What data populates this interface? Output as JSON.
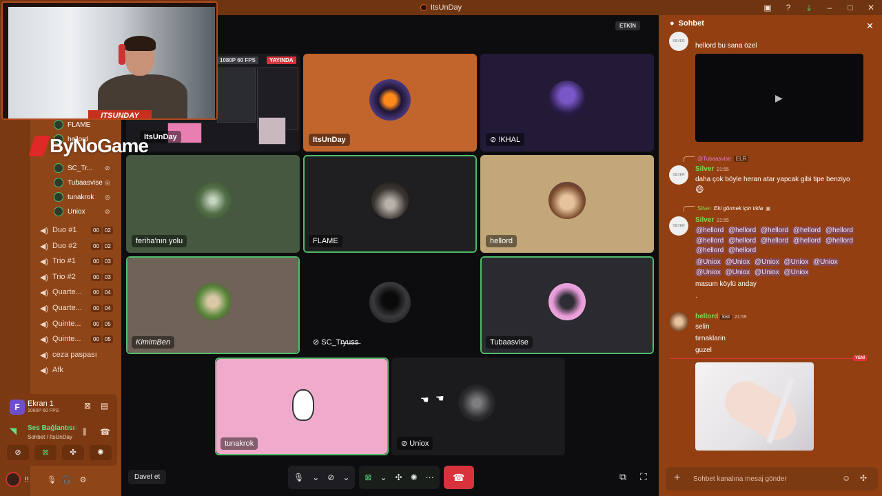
{
  "window": {
    "title": "ItsUnDay"
  },
  "titlebar_icons": [
    "inbox-icon",
    "help-icon",
    "download-icon",
    "minimize-icon",
    "maximize-icon",
    "close-icon"
  ],
  "overlay": {
    "banner": "ITSUNDAY",
    "brand": "ByNoGame"
  },
  "voice_members": [
    {
      "name": "FLAME"
    },
    {
      "name": "hellord"
    },
    {
      "name": "SC_Tr..."
    },
    {
      "name": "Tubaasvise"
    },
    {
      "name": "tunakrok"
    },
    {
      "name": "Uniox"
    }
  ],
  "voice_channels": [
    {
      "name": "Duo #1",
      "a": "00",
      "b": "02"
    },
    {
      "name": "Duo #2",
      "a": "00",
      "b": "02"
    },
    {
      "name": "Trio #1",
      "a": "00",
      "b": "03"
    },
    {
      "name": "Trio #2",
      "a": "00",
      "b": "03"
    },
    {
      "name": "Quarte...",
      "a": "00",
      "b": "04"
    },
    {
      "name": "Quarte...",
      "a": "00",
      "b": "04"
    },
    {
      "name": "Quinte...",
      "a": "00",
      "b": "05"
    },
    {
      "name": "Quinte...",
      "a": "00",
      "b": "05"
    },
    {
      "name": "ceza paspası",
      "a": "",
      "b": ""
    },
    {
      "name": "Afk",
      "a": "",
      "b": ""
    }
  ],
  "screen_share": {
    "icon_letter": "F",
    "title": "Ekran 1",
    "sub": "1080P 60 FPS"
  },
  "voice_connection": {
    "title": "Ses Bağlantısı K",
    "sub": "Sohbet / ItsUnDay"
  },
  "user": {
    "name": "!!"
  },
  "stage": {
    "etkin": "ETKİN",
    "preview": {
      "fps": "1080P 60 FPS",
      "live": "YAYINDA",
      "label": "ItsUnDay"
    },
    "tiles": [
      {
        "label": "ItsUnDay",
        "bg": "#c2652d"
      },
      {
        "label": "!KHAL",
        "bg": "#221a36"
      },
      {
        "label": "feriha'nın yolu",
        "bg": "#46583f"
      },
      {
        "label": "FLAME",
        "bg": "#1f1f22"
      },
      {
        "label": "hellord",
        "bg": "#c2a878"
      },
      {
        "label": "KimimBen",
        "bg": "#6f6358"
      },
      {
        "label": "SC_Tr̶y̶u̶s̶s̶",
        "bg": "#0d0d10"
      },
      {
        "label": "Tubaasvise",
        "bg": "#2a2a30"
      },
      {
        "label": "tunakrok",
        "bg": "#f0aacb"
      },
      {
        "label": "Uniox",
        "bg": "#1b1b1e"
      }
    ],
    "invite": "Davet et"
  },
  "chat": {
    "title": "Sohbet",
    "msg0": {
      "text": "hellord bu sana özel"
    },
    "msg1": {
      "reply_name": "@Tubaasvise",
      "reply_tag": "ELR",
      "name": "Silver",
      "time": "21:55",
      "text": "daha çok böyle heran atar yapcak gibi tipe benziyo"
    },
    "msg2": {
      "reply_name": "Silver",
      "reply_text": "Eki görmek için tıkla",
      "name": "Silver",
      "time": "21:55",
      "line1": [
        "@hellord",
        "@hellord",
        "@hellord",
        "@hellord",
        "@hellord"
      ],
      "line2": [
        "@hellord",
        "@hellord",
        "@hellord",
        "@hellord",
        "@hellord"
      ],
      "line3": [
        "@hellord",
        "@hellord"
      ],
      "line4": [
        "@Uniox",
        "@Uniox",
        "@Uniox",
        "@Uniox",
        "@Uniox"
      ],
      "line5": [
        "@Uniox",
        "@Uniox",
        "@Uniox",
        "@Uniox"
      ],
      "text1": "masum köylü anday",
      "text2": "."
    },
    "msg3": {
      "name": "hellord",
      "tag": "lost",
      "time": "21:59",
      "lines": [
        "selin",
        "tırnaklarin",
        "guzel"
      ]
    },
    "new_badge": "YENİ",
    "input_placeholder": "Sohbet kanalına mesaj gönder",
    "avatar_text": "SILVER"
  }
}
